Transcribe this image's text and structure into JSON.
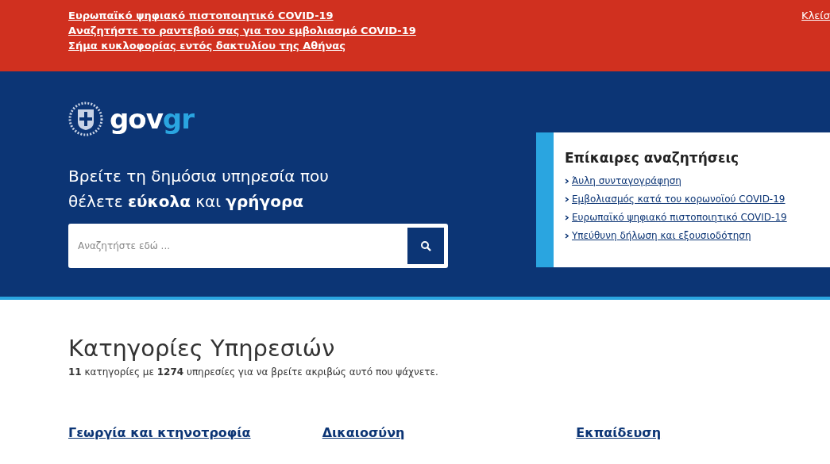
{
  "alert_banner": {
    "links": [
      "Ευρωπαϊκό ψηφιακό πιστοποιητικό COVID-19",
      "Αναζητήστε το ραντεβού σας για τον εμβολιασμό COVID-19 ",
      "Σήμα κυκλοφορίας εντός δακτυλίου της Αθήνας"
    ],
    "close_link": "Κλείσ"
  },
  "hero": {
    "logo": {
      "part_1": "gov",
      "part_2": "gr"
    },
    "headline_line_1": "Βρείτε τη δημόσια υπηρεσία που",
    "headline_line_2": "θέλετε **εύκολα** και **γρήγορα**",
    "search": {
      "placeholder": "Αναζητήστε εδώ ..."
    },
    "popular_searches": {
      "title": "Επίκαιρες αναζητήσεις",
      "links": [
        "Άυλη συνταγογράφηση",
        "Εμβολιασμός κατά του κορωνοϊού COVID-19",
        "Ευρωπαϊκό ψηφιακό πιστοποιητικό COVID-19",
        "Υπεύθυνη δήλωση και εξουσιοδότηση"
      ]
    }
  },
  "categories": {
    "title": "Κατηγορίες Υπηρεσιών",
    "subtitle": "**11** κατηγορίες με **1274** υπηρεσίες για να βρείτε ακριβώς αυτό που ψάχνετε.",
    "items": [
      {
        "title": "Γεωργία και κτηνοτροφία"
      },
      {
        "title": "Δικαιοσύνη"
      },
      {
        "title": "Εκπαίδευση"
      }
    ]
  }
}
